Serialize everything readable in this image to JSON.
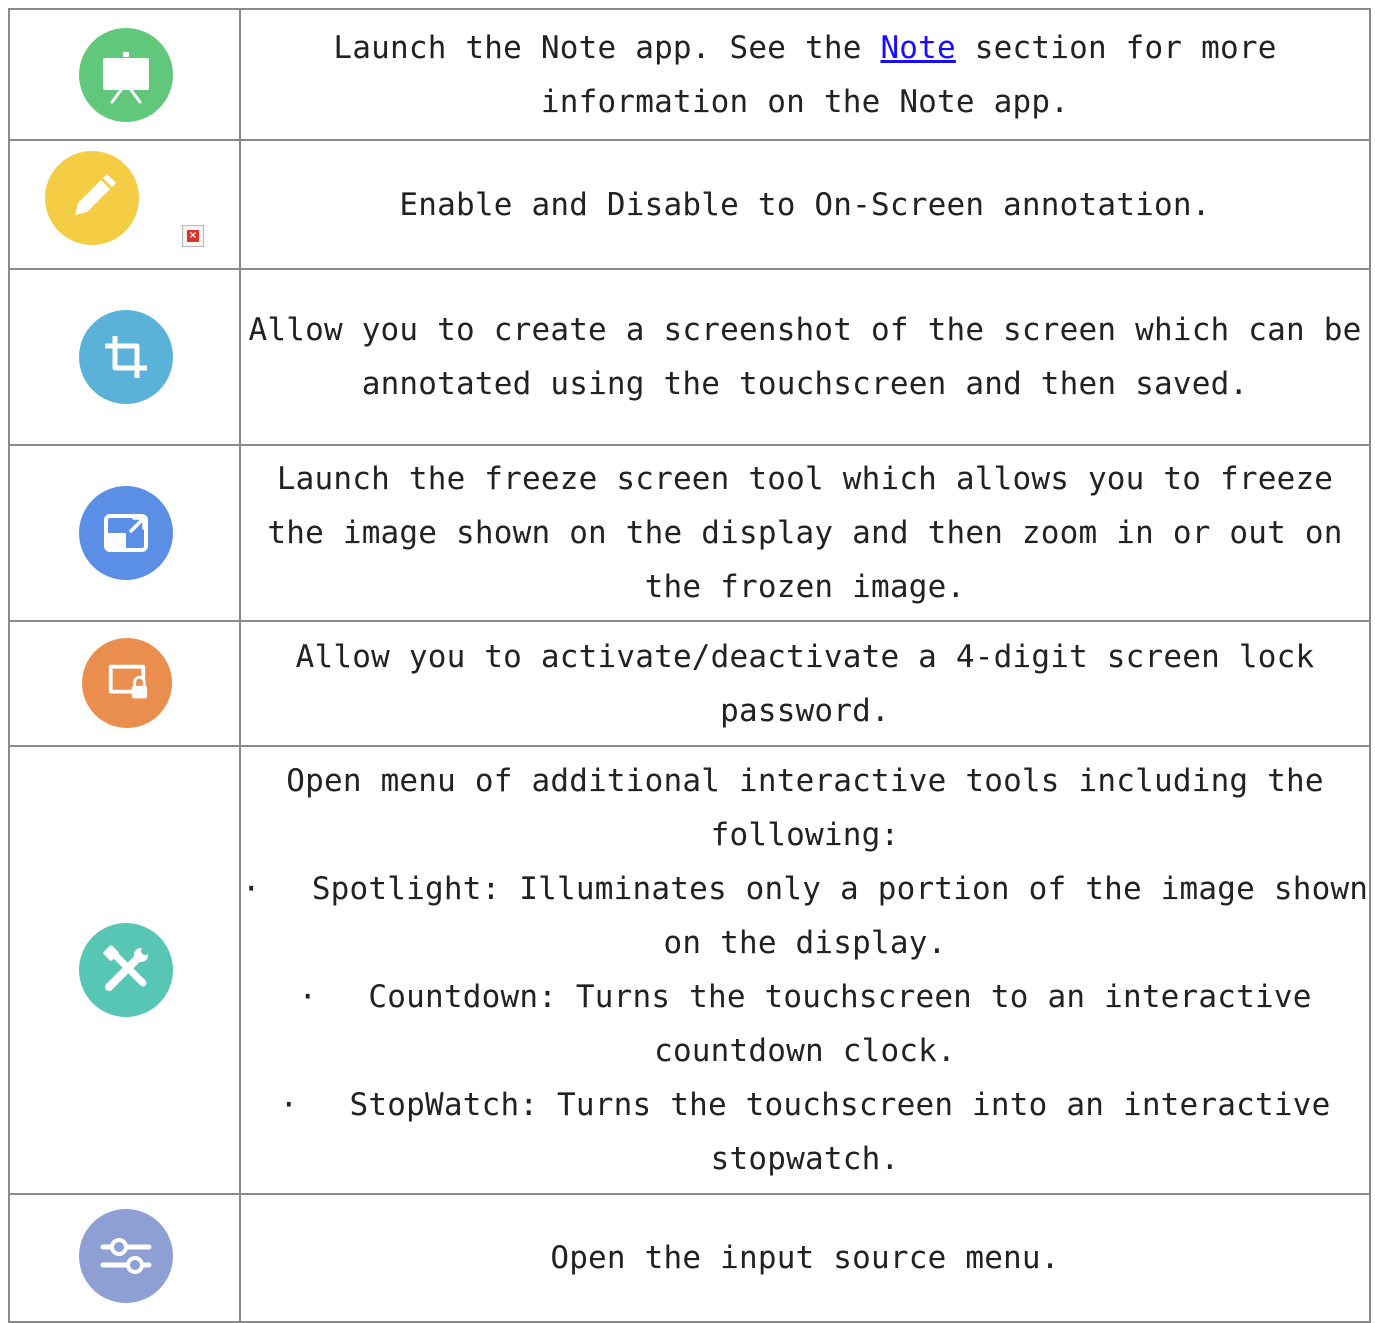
{
  "rows": [
    {
      "icon": "presentation-board-icon",
      "color": "#61c77a",
      "text_before": "Launch the Note app. See the ",
      "link_text": "Note",
      "text_after": " section for more information on the Note app."
    },
    {
      "icon": "pencil-icon",
      "color": "#f4cd45",
      "text": "Enable and Disable to On-Screen annotation."
    },
    {
      "icon": "crop-icon",
      "color": "#5ab2d9",
      "text": "Allow you to create a screenshot of the screen which can be annotated using the touchscreen and then saved."
    },
    {
      "icon": "resize-screen-icon",
      "color": "#5a8fe5",
      "text": "Launch the freeze screen tool which allows you to freeze the image shown on the display and then zoom in or out on the frozen image."
    },
    {
      "icon": "screen-lock-icon",
      "color": "#e98e4e",
      "text": "Allow you to activate/deactivate a 4-digit screen lock password."
    },
    {
      "icon": "tools-icon",
      "color": "#58c6b5",
      "intro": "Open menu of additional interactive tools including the following:",
      "bullet": "·",
      "items": [
        "Spotlight: Illuminates only a portion of the image shown on the display.",
        "Countdown: Turns the touchscreen to an interactive countdown clock.",
        "StopWatch: Turns the touchscreen into an interactive stopwatch."
      ]
    },
    {
      "icon": "sliders-icon",
      "color": "#8e9fd4",
      "text": "Open the input source menu."
    }
  ],
  "broken_image_icon": "broken-image-icon"
}
